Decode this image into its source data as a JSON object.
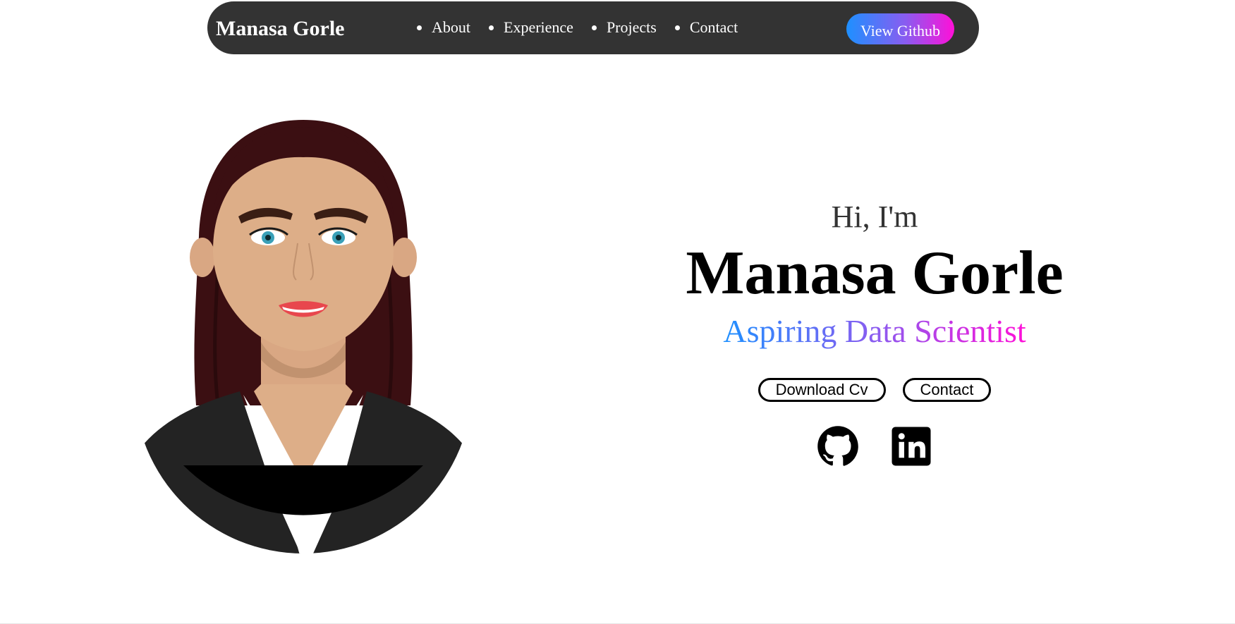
{
  "nav": {
    "brand": "Manasa Gorle",
    "items": [
      {
        "label": "About"
      },
      {
        "label": "Experience"
      },
      {
        "label": "Projects"
      },
      {
        "label": "Contact"
      }
    ],
    "github_button": "View Github"
  },
  "hero": {
    "greeting": "Hi, I'm",
    "name": "Manasa Gorle",
    "role": "Aspiring Data Scientist",
    "buttons": {
      "download_cv": "Download Cv",
      "contact": "Contact"
    },
    "social": {
      "github": "github-icon",
      "linkedin": "linkedin-icon"
    }
  },
  "colors": {
    "nav_bg": "#333333",
    "gradient_start": "#1e90ff",
    "gradient_mid": "#8a5cf0",
    "gradient_end": "#ff10d8",
    "hair": "#3b0f12",
    "skin": "#ddae88",
    "jacket": "#232323"
  }
}
